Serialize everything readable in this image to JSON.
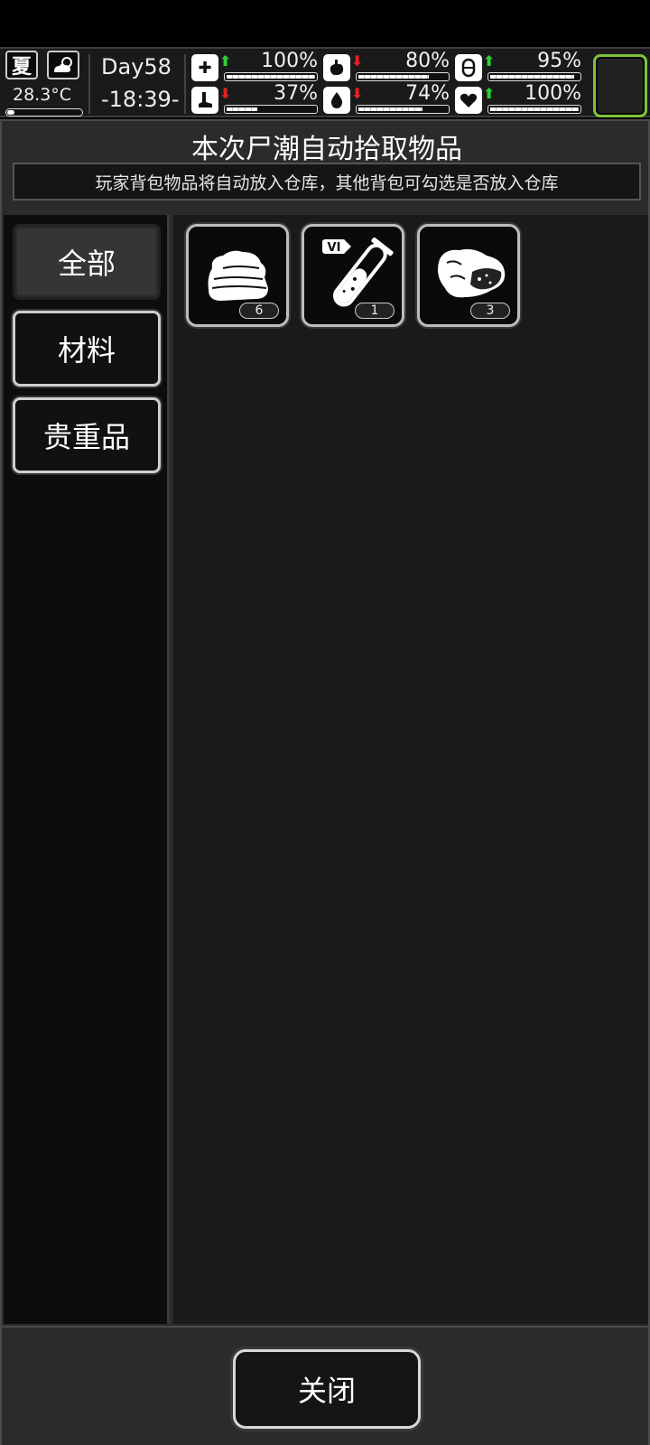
{
  "status": {
    "season": "夏",
    "temperature": "28.3°C",
    "temperature_level": 0.1,
    "day": "Day58",
    "time": "-18:39-",
    "stats": [
      {
        "name": "health",
        "icon": "medkit-icon",
        "trend": "up",
        "value": "100%",
        "level": 1.0
      },
      {
        "name": "stamina",
        "icon": "leg-icon",
        "trend": "down",
        "value": "37%",
        "level": 0.37
      },
      {
        "name": "hunger",
        "icon": "stomach-icon",
        "trend": "down",
        "value": "80%",
        "level": 0.8
      },
      {
        "name": "thirst",
        "icon": "water-drop-icon",
        "trend": "down",
        "value": "74%",
        "level": 0.74
      },
      {
        "name": "medicine",
        "icon": "pill-icon",
        "trend": "up",
        "value": "95%",
        "level": 0.95
      },
      {
        "name": "mood",
        "icon": "heart-icon",
        "trend": "up",
        "value": "100%",
        "level": 1.0
      }
    ],
    "accent_color": "#7ec23a",
    "trend_up_color": "#2ed12e",
    "trend_down_color": "#e22121"
  },
  "panel": {
    "title": "本次尸潮自动拾取物品",
    "subtitle": "玩家背包物品将自动放入仓库，其他背包可勾选是否放入仓库"
  },
  "tabs": [
    {
      "label": "全部",
      "active": true
    },
    {
      "label": "材料",
      "active": false
    },
    {
      "label": "贵重品",
      "active": false
    }
  ],
  "items": [
    {
      "icon": "cloth-icon",
      "count": "6"
    },
    {
      "icon": "test-tube-vi-icon",
      "count": "1",
      "tag": "VI"
    },
    {
      "icon": "raw-meat-icon",
      "count": "3"
    }
  ],
  "close_label": "关闭"
}
